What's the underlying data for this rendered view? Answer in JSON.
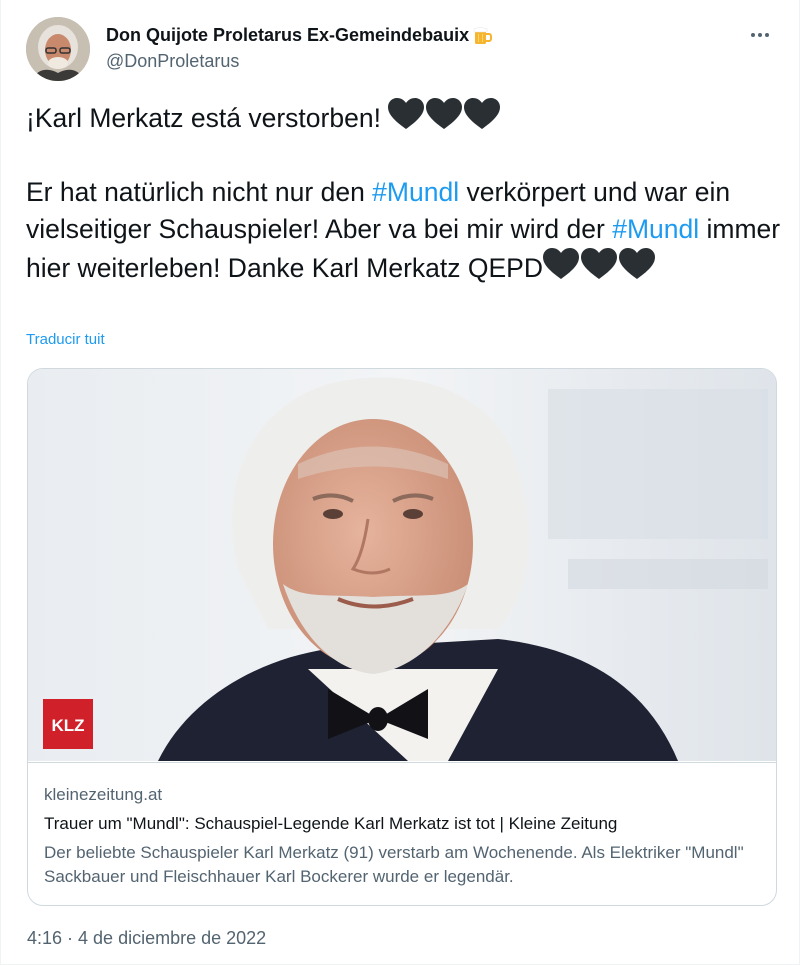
{
  "author": {
    "display_name": "Don Quijote Proletarus Ex-Gemeindebauix",
    "name_emoji": "beer-mug-icon",
    "handle": "@DonProletarus"
  },
  "menu": {
    "icon": "more-horizontal-icon"
  },
  "tweet": {
    "line1": "¡Karl Merkatz está verstorben!",
    "p2_part1": "Er hat natürlich nicht nur den ",
    "hashtag1": "#Mundl",
    "p2_part2": " verkörpert und war ein vielseitiger Schauspieler! Aber va bei mir wird der ",
    "hashtag2": "#Mundl",
    "p2_part3": " immer hier weiterleben! Danke Karl Merkatz QEPD",
    "emoji": "black-heart-icon"
  },
  "translate_label": "Traducir tuit",
  "card": {
    "logo_text": "KLZ",
    "domain": "kleinezeitung.at",
    "title": "Trauer um \"Mundl\": Schauspiel-Legende Karl Merkatz ist tot | Kleine Zeitung",
    "description": "Der beliebte Schauspieler Karl Merkatz (91) verstarb am Wochenende. Als Elektriker \"Mundl\" Sackbauer und Fleischhauer Karl Bockerer wurde er legendär."
  },
  "timestamp": "4:16 · 4 de diciembre de 2022",
  "colors": {
    "link": "#1d9bf0",
    "text": "#0f1419",
    "secondary": "#536471",
    "logo_bg": "#d0202a"
  }
}
